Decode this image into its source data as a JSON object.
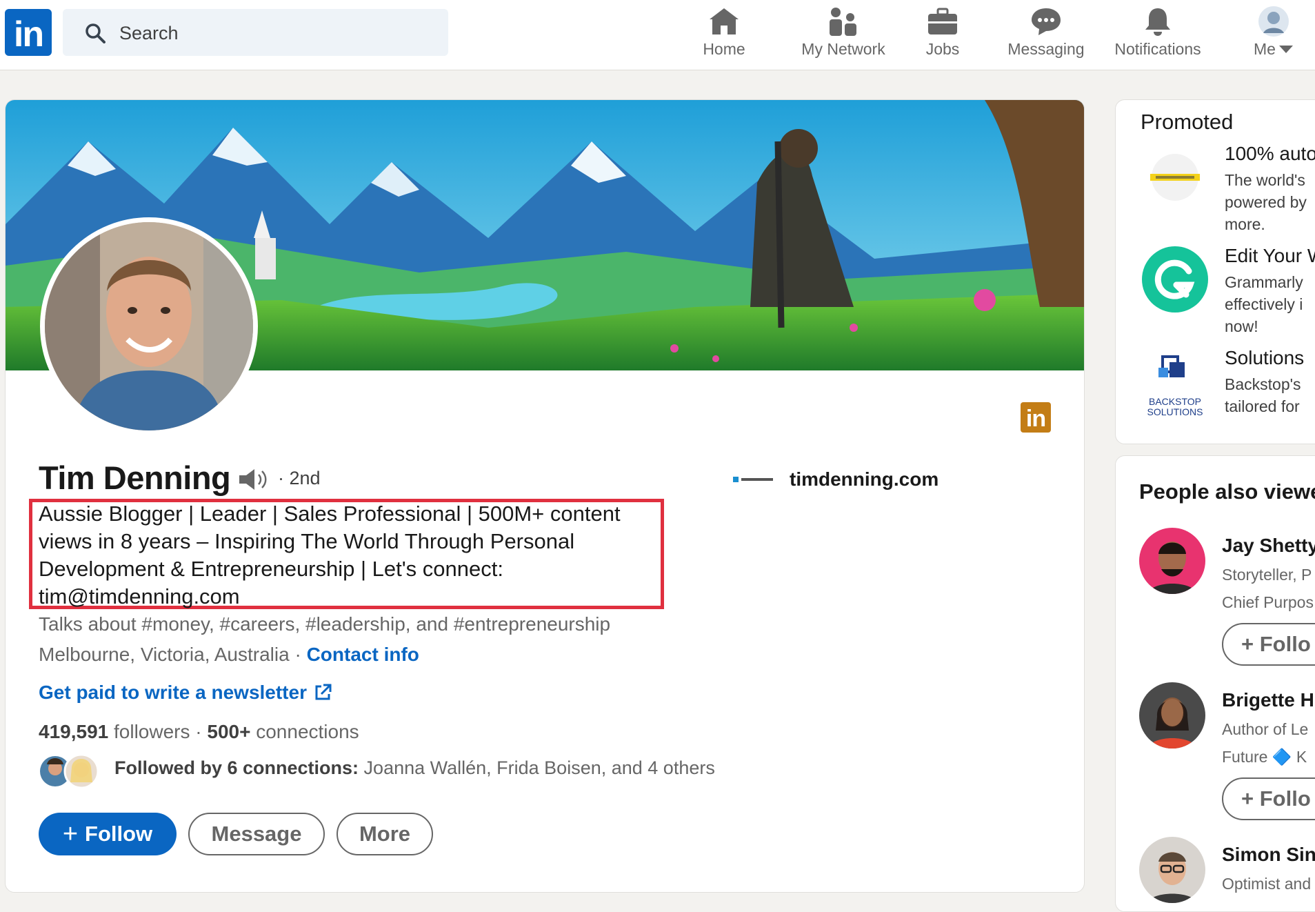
{
  "nav": {
    "logo": "in",
    "search_placeholder": "Search",
    "items": [
      {
        "label": "Home",
        "icon": "home-icon"
      },
      {
        "label": "My Network",
        "icon": "network-icon"
      },
      {
        "label": "Jobs",
        "icon": "briefcase-icon"
      },
      {
        "label": "Messaging",
        "icon": "messaging-icon"
      },
      {
        "label": "Notifications",
        "icon": "bell-icon"
      },
      {
        "label": "Me",
        "icon": "avatar-icon"
      }
    ]
  },
  "profile": {
    "name": "Tim Denning",
    "degree": "· 2nd",
    "website": "timdenning.com",
    "headline": "Aussie Blogger | Leader | Sales Professional | 500M+ content views in 8 years – Inspiring The World Through Personal Development & Entrepreneurship | Let's connect: tim@timdenning.com",
    "talks_about": "Talks about #money, #careers, #leadership, and #entrepreneurship",
    "location": "Melbourne, Victoria, Australia",
    "location_sep": " · ",
    "contact_info": "Contact info",
    "newsletter": "Get paid to write a newsletter",
    "followers_count": "419,591",
    "followers_label": " followers",
    "stats_sep": "  · ",
    "connections_count": "500+",
    "connections_label": " connections",
    "followed_by_bold": "Followed by 6 connections:",
    "followed_by_names": " Joanna Wallén, Frida Boisen, and 4 others",
    "buttons": {
      "follow": "Follow",
      "message": "Message",
      "more": "More"
    },
    "badge": "in"
  },
  "promoted": {
    "title": "Promoted",
    "ads": [
      {
        "headline": "100% auto",
        "body": "The world's\npowered by\nmore.",
        "logo": "autotix-logo"
      },
      {
        "headline": "Edit Your W",
        "body": "Grammarly\neffectively i\nnow!",
        "logo": "grammarly-logo"
      },
      {
        "headline": "Solutions",
        "body": "Backstop's\ntailored for",
        "logo": "backstop-logo",
        "logo_text": "BACKSTOP SOLUTIONS"
      }
    ]
  },
  "people_also_viewed": {
    "title": "People also viewed",
    "people": [
      {
        "name": "Jay Shetty",
        "line1": "Storyteller, P",
        "line2": "Chief Purpos",
        "follow": "Follo"
      },
      {
        "name": "Brigette H",
        "line1": "Author of Le",
        "line2": "Future  🔷  K",
        "follow": "Follo"
      },
      {
        "name": "Simon Sin",
        "line1": "Optimist and",
        "line2": "",
        "follow": ""
      }
    ]
  },
  "colors": {
    "brand": "#0a66c2",
    "highlight": "#e0303f",
    "badge": "#c37d16"
  }
}
